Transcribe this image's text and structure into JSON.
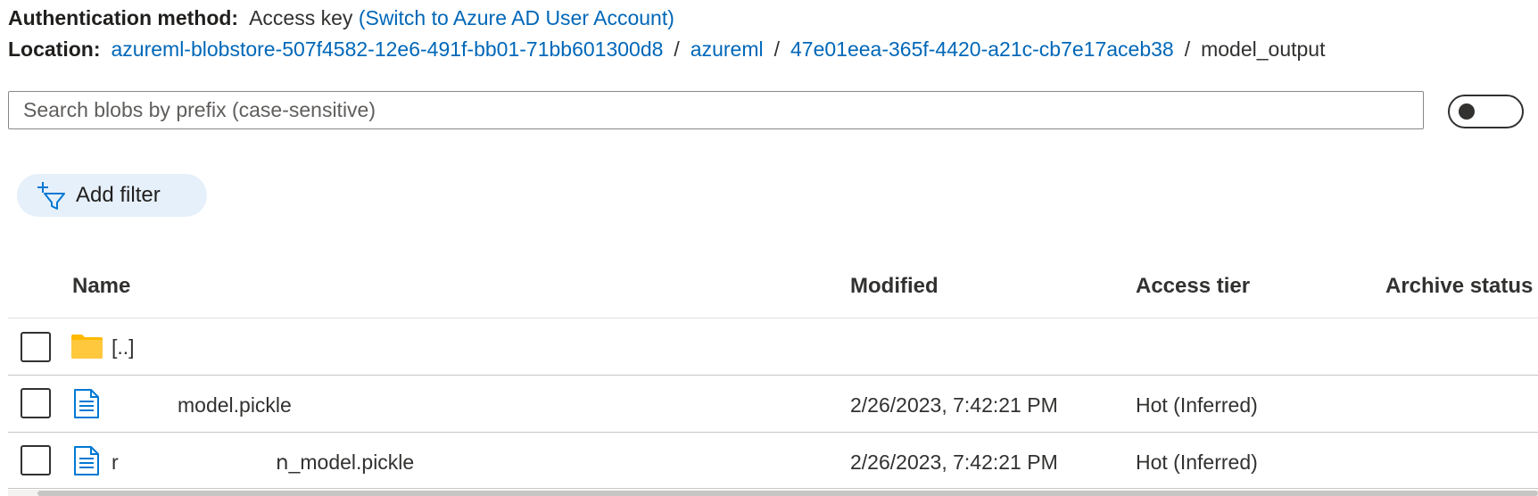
{
  "auth": {
    "label": "Authentication method:",
    "value": "Access key",
    "switch_link": "(Switch to Azure AD User Account)"
  },
  "location": {
    "label": "Location:",
    "crumbs": [
      "azureml-blobstore-507f4582-12e6-491f-bb01-71bb601300d8",
      "azureml",
      "47e01eea-365f-4420-a21c-cb7e17aceb38"
    ],
    "separator": "/",
    "current": "model_output"
  },
  "search": {
    "placeholder": "Search blobs by prefix (case-sensitive)",
    "value": ""
  },
  "toggle": {
    "state": "off"
  },
  "filter": {
    "label": "Add filter"
  },
  "table": {
    "columns": [
      "Name",
      "Modified",
      "Access tier",
      "Archive status"
    ],
    "parent_row": {
      "name": "[..]"
    },
    "rows": [
      {
        "name_prefix": "",
        "name": "model.pickle",
        "modified": "2/26/2023, 7:42:21 PM",
        "tier": "Hot (Inferred)"
      },
      {
        "name_prefix": "r",
        "name": "ո_model.pickle",
        "modified": "2/26/2023, 7:42:21 PM",
        "tier": "Hot (Inferred)"
      }
    ]
  },
  "colors": {
    "link": "#0067b8",
    "folder": "#ffb900",
    "file_icon": "#0078d4",
    "filter_bg": "#e6f0fa"
  }
}
